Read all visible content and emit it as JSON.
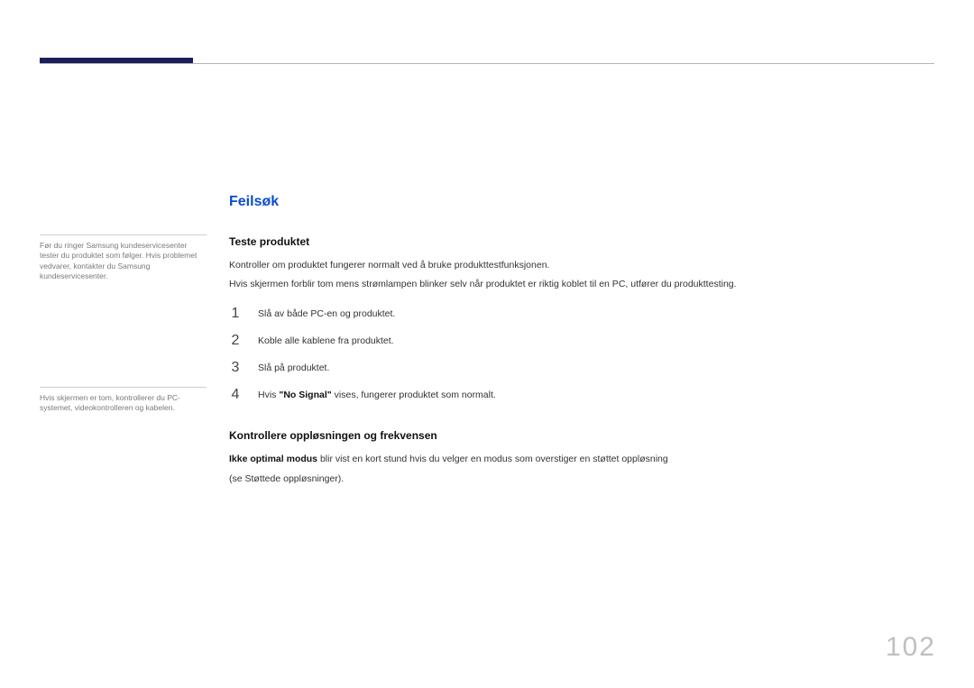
{
  "sidebar": {
    "note1": "Før du ringer Samsung kundeservicesenter tester du produktet som følger. Hvis problemet vedvarer, kontakter du Samsung kundeservicesenter.",
    "note2": "Hvis skjermen er tom, kontrollerer du PC-systemet, videokontrolleren og kabelen."
  },
  "main": {
    "heading": "Feilsøk",
    "section1": {
      "title": "Teste produktet",
      "p1": "Kontroller om produktet fungerer normalt ved å bruke produkttestfunksjonen.",
      "p2": "Hvis skjermen forblir tom mens strømlampen blinker selv når produktet er riktig koblet til en PC, utfører du produkttesting.",
      "steps": [
        {
          "n": "1",
          "t": "Slå av både PC-en og produktet."
        },
        {
          "n": "2",
          "t": "Koble alle kablene fra produktet."
        },
        {
          "n": "3",
          "t": "Slå på produktet."
        },
        {
          "n": "4",
          "prefix": "Hvis ",
          "bold": "\"No Signal\"",
          "suffix": " vises, fungerer produktet som normalt."
        }
      ]
    },
    "section2": {
      "title": "Kontrollere oppløsningen og frekvensen",
      "p1_bold": "Ikke optimal modus",
      "p1_rest": " blir vist en kort stund hvis du velger en modus som overstiger en støttet oppløsning",
      "p2": "(se Støttede oppløsninger)."
    }
  },
  "page_number": "102"
}
